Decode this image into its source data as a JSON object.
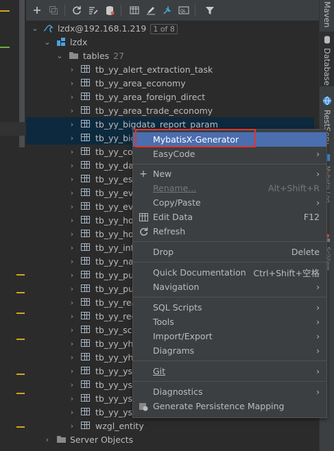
{
  "colors": {
    "accent": "#4b6eaf",
    "selection": "#0d293e",
    "highlight_box": "#e0352f",
    "warning_mark": "#d4a526"
  },
  "toolbar": {
    "buttons": [
      "add-icon",
      "duplicate-icon",
      "refresh-icon",
      "properties-icon",
      "schema-icon",
      "table-icon",
      "edit-icon",
      "jump-icon",
      "console-icon",
      "filter-icon"
    ]
  },
  "tree": {
    "connection": {
      "label": "lzdx@192.168.1.219",
      "badge": "1 of 8"
    },
    "schema": {
      "label": "lzdx"
    },
    "tables": {
      "label": "tables",
      "count": "27"
    },
    "table_rows": [
      "tb_yy_alert_extraction_task",
      "tb_yy_area_economy",
      "tb_yy_area_foreign_direct",
      "tb_yy_area_trade_economy",
      "tb_yy_bigdata_report_param",
      "tb_yy_big",
      "tb_yy_co",
      "tb_yy_da",
      "tb_yy_es_",
      "tb_yy_eve",
      "tb_yy_eve",
      "tb_yy_ho",
      "tb_yy_ho",
      "tb_yy_int",
      "tb_yy_nat",
      "tb_yy_pu",
      "tb_yy_pu",
      "tb_yy_rea",
      "tb_yy_reg",
      "tb_yy_sci",
      "tb_yy_yhl",
      "tb_yy_yhl",
      "tb_yy_ysp",
      "tb_yy_ysp",
      "tb_yy_ysp",
      "tb_yy_ysp",
      "wzgl_entity"
    ],
    "server_objects": {
      "label": "Server Objects"
    }
  },
  "right_tabs": {
    "maven": "Maven",
    "database": "Database",
    "restservices": "RestServices",
    "mybatis": "Mybatis Log",
    "sciview": "SciView"
  },
  "menu": {
    "mybatisx": "MybatisX-Generator",
    "easycode": "EasyCode",
    "new": "New",
    "rename": "Rename...",
    "rename_sc": "Alt+Shift+R",
    "copypaste": "Copy/Paste",
    "editdata": "Edit Data",
    "editdata_sc": "F12",
    "refresh": "Refresh",
    "drop": "Drop",
    "drop_sc": "Delete",
    "quickdoc": "Quick Documentation",
    "quickdoc_sc": "Ctrl+Shift+空格",
    "navigation": "Navigation",
    "sqlscripts": "SQL Scripts",
    "tools": "Tools",
    "importexport": "Import/Export",
    "diagrams": "Diagrams",
    "git": "Git",
    "diagnostics": "Diagnostics",
    "genpersist": "Generate Persistence Mapping"
  }
}
